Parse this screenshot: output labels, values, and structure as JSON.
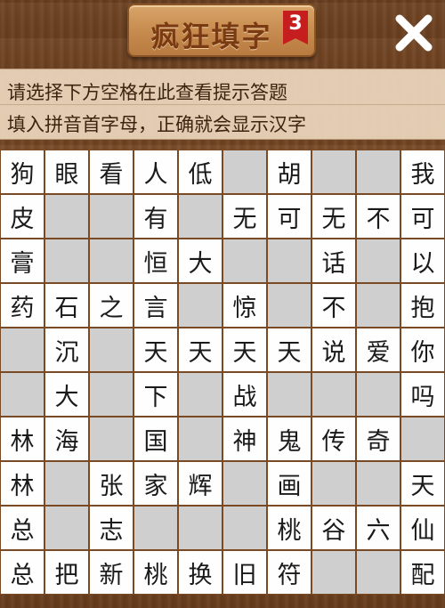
{
  "header": {
    "title": "疯狂填字",
    "level": "3",
    "close_icon": "close-x-icon"
  },
  "hints": {
    "line1": "请选择下方空格在此查看提示答题",
    "line2": "填入拼音首字母，正确就会显示汉字"
  },
  "colors": {
    "wood": "#6b4020",
    "cell_filled": "#fefefe",
    "cell_empty": "#cfcfcf",
    "badge": "#c61e1e"
  },
  "grid": [
    [
      "狗",
      "眼",
      "看",
      "人",
      "低",
      "",
      "胡",
      "",
      "",
      "我"
    ],
    [
      "皮",
      "",
      "",
      "有",
      "",
      "无",
      "可",
      "无",
      "不",
      "可"
    ],
    [
      "膏",
      "",
      "",
      "恒",
      "大",
      "",
      "",
      "话",
      "",
      "以"
    ],
    [
      "药",
      "石",
      "之",
      "言",
      "",
      "惊",
      "",
      "不",
      "",
      "抱"
    ],
    [
      "",
      "沉",
      "",
      "天",
      "天",
      "天",
      "天",
      "说",
      "爱",
      "你"
    ],
    [
      "",
      "大",
      "",
      "下",
      "",
      "战",
      "",
      "",
      "",
      "吗"
    ],
    [
      "林",
      "海",
      "",
      "国",
      "",
      "神",
      "鬼",
      "传",
      "奇",
      ""
    ],
    [
      "林",
      "",
      "张",
      "家",
      "辉",
      "",
      "画",
      "",
      "",
      "天"
    ],
    [
      "总",
      "",
      "志",
      "",
      "",
      "",
      "桃",
      "谷",
      "六",
      "仙"
    ],
    [
      "总",
      "把",
      "新",
      "桃",
      "换",
      "旧",
      "符",
      "",
      "",
      "配"
    ]
  ]
}
